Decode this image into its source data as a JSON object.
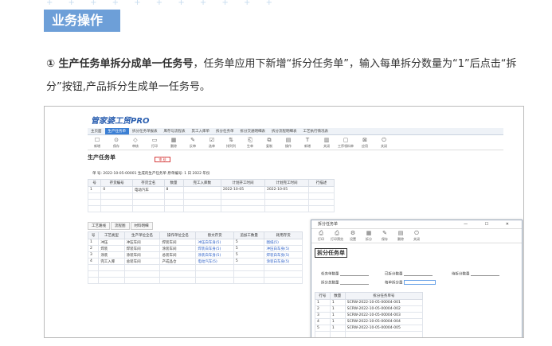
{
  "section": {
    "tag": "业务操作"
  },
  "intro": {
    "bold": "① 生产任务单拆分成单一任务号",
    "rest": "，任务单应用下新增“拆分任务单”，输入每单拆分数量为“1”后点击“拆分”按钮,产品拆分生成单一任务号。"
  },
  "app": {
    "logo": "管家婆工贸PRO",
    "tabs": [
      "主页面",
      "生产任务单",
      "拆分任务单报表",
      "库存与流程表",
      "其工入库单",
      "拆分任务单",
      "拆分交通明细表",
      "拆分流程明细表",
      "工艺执行情况表"
    ],
    "active_tab": 1,
    "toolbar": [
      {
        "icon": "☐",
        "label": "新增"
      },
      {
        "icon": "⊙",
        "label": "保存"
      },
      {
        "icon": "◇",
        "label": "审核"
      },
      {
        "icon": "▭",
        "label": "打印"
      },
      {
        "icon": "▦",
        "label": "删除"
      },
      {
        "icon": "✎",
        "label": "反审"
      },
      {
        "icon": "☑",
        "label": "选单"
      },
      {
        "icon": "⇅",
        "label": "排列列"
      },
      {
        "icon": "⎗",
        "label": "生单"
      },
      {
        "icon": "⧉",
        "label": "复制"
      },
      {
        "icon": "▤",
        "label": "操作"
      },
      {
        "icon": "T",
        "label": "新增"
      },
      {
        "icon": "▥",
        "label": "关闭"
      },
      {
        "icon": "▢",
        "label": "工序领料单"
      },
      {
        "icon": "⊠",
        "label": "应用"
      },
      {
        "icon": "⏻",
        "label": "关闭"
      }
    ],
    "form_title": "生产任务单",
    "stamp": "审 核",
    "order_line": "单 号: 2022-10-05-00001  生成的生产任务单  原单编号: 1        日    2022 年份",
    "main_table": {
      "headers": [
        "号",
        "存货编号",
        "存货全名",
        "数量",
        "完工入库数",
        "计划开工时间",
        "计划完工时间",
        "行描述"
      ],
      "rows": [
        [
          "1",
          "0",
          "电动汽车",
          "8",
          "",
          "2022-10-05",
          "2022-10-05",
          ""
        ]
      ]
    },
    "sub_tabs": [
      "工艺路线",
      "流程图",
      "材料明细"
    ],
    "process_table": {
      "headers": [
        "号",
        "工艺类型",
        "生产单位全名",
        "操作单位全名",
        "替文存货",
        "追加工数量",
        "耗用存货"
      ],
      "rows": [
        [
          "1",
          "冲压",
          "冲压车间",
          "焊装车间",
          "冲压白车身(5)",
          "5",
          "图纸(5)"
        ],
        [
          "2",
          "焊装",
          "焊装车间",
          "涂装车间",
          "焊装白车身(5)",
          "5",
          "冲压白车身(5)"
        ],
        [
          "3",
          "涂装",
          "涂装车间",
          "总装车间",
          "涂装白车身(5)",
          "5",
          "焊装白车身(5)"
        ],
        [
          "4",
          "完工入库",
          "总装车间",
          "产成品仓",
          "电动汽车(5)",
          "5",
          "涂装白车身(5)"
        ]
      ]
    }
  },
  "dialog": {
    "title": "拆分任务单",
    "toolbar": [
      {
        "icon": "⎙",
        "label": "打印"
      },
      {
        "icon": "⎙",
        "label": "打印预览"
      },
      {
        "icon": "⚙",
        "label": "设置"
      },
      {
        "icon": "▦",
        "label": "拆分"
      },
      {
        "icon": "✎",
        "label": "保存"
      },
      {
        "icon": "▤",
        "label": "删除"
      },
      {
        "icon": "⏻",
        "label": "关闭"
      }
    ],
    "heading": "拆分任务单",
    "fields": {
      "task_qty": "任务单数量",
      "split_qty": "已拆分数量",
      "pending_qty": "待拆分数量",
      "total_qty": "拆分总数量",
      "per_qty": "每单拆分量"
    },
    "table": {
      "headers": [
        "行号",
        "数量",
        "拆分任务单号"
      ],
      "rows": [
        [
          "1",
          "1",
          "SCRW-2022-10-05-00004-001"
        ],
        [
          "2",
          "1",
          "SCRW-2022-10-05-00004-002"
        ],
        [
          "3",
          "1",
          "SCRW-2022-10-05-00004-003"
        ],
        [
          "4",
          "1",
          "SCRW-2022-10-05-00004-004"
        ],
        [
          "5",
          "1",
          "SCRW-2022-10-05-00004-005"
        ]
      ]
    }
  }
}
